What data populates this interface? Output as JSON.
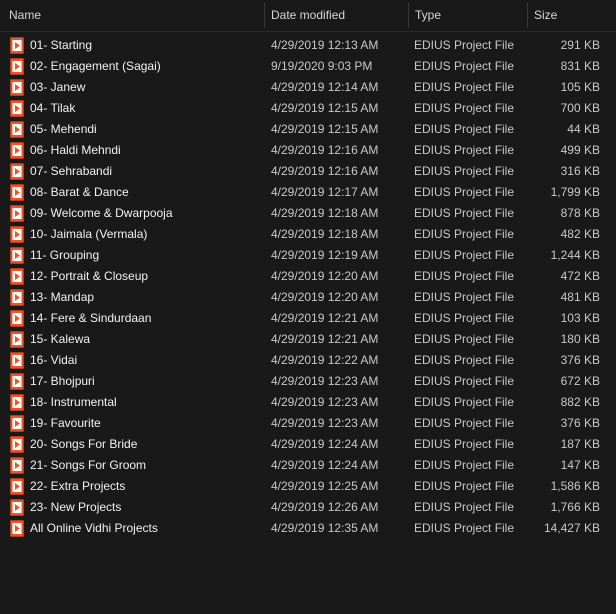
{
  "columns": {
    "name": "Name",
    "date": "Date modified",
    "type": "Type",
    "size": "Size"
  },
  "colors": {
    "icon": "#e8562a",
    "background": "#191919"
  },
  "icon_name": "edius-project-file-icon",
  "files": [
    {
      "name": "01- Starting",
      "date": "4/29/2019 12:13 AM",
      "type": "EDIUS Project File",
      "size": "291 KB"
    },
    {
      "name": "02- Engagement (Sagai)",
      "date": "9/19/2020 9:03 PM",
      "type": "EDIUS Project File",
      "size": "831 KB"
    },
    {
      "name": "03- Janew",
      "date": "4/29/2019 12:14 AM",
      "type": "EDIUS Project File",
      "size": "105 KB"
    },
    {
      "name": "04- Tilak",
      "date": "4/29/2019 12:15 AM",
      "type": "EDIUS Project File",
      "size": "700 KB"
    },
    {
      "name": "05- Mehendi",
      "date": "4/29/2019 12:15 AM",
      "type": "EDIUS Project File",
      "size": "44 KB"
    },
    {
      "name": "06- Haldi Mehndi",
      "date": "4/29/2019 12:16 AM",
      "type": "EDIUS Project File",
      "size": "499 KB"
    },
    {
      "name": "07- Sehrabandi",
      "date": "4/29/2019 12:16 AM",
      "type": "EDIUS Project File",
      "size": "316 KB"
    },
    {
      "name": "08- Barat & Dance",
      "date": "4/29/2019 12:17 AM",
      "type": "EDIUS Project File",
      "size": "1,799 KB"
    },
    {
      "name": "09- Welcome & Dwarpooja",
      "date": "4/29/2019 12:18 AM",
      "type": "EDIUS Project File",
      "size": "878 KB"
    },
    {
      "name": "10- Jaimala (Vermala)",
      "date": "4/29/2019 12:18 AM",
      "type": "EDIUS Project File",
      "size": "482 KB"
    },
    {
      "name": "11- Grouping",
      "date": "4/29/2019 12:19 AM",
      "type": "EDIUS Project File",
      "size": "1,244 KB"
    },
    {
      "name": "12- Portrait & Closeup",
      "date": "4/29/2019 12:20 AM",
      "type": "EDIUS Project File",
      "size": "472 KB"
    },
    {
      "name": "13- Mandap",
      "date": "4/29/2019 12:20 AM",
      "type": "EDIUS Project File",
      "size": "481 KB"
    },
    {
      "name": "14- Fere & Sindurdaan",
      "date": "4/29/2019 12:21 AM",
      "type": "EDIUS Project File",
      "size": "103 KB"
    },
    {
      "name": "15- Kalewa",
      "date": "4/29/2019 12:21 AM",
      "type": "EDIUS Project File",
      "size": "180 KB"
    },
    {
      "name": "16- Vidai",
      "date": "4/29/2019 12:22 AM",
      "type": "EDIUS Project File",
      "size": "376 KB"
    },
    {
      "name": "17- Bhojpuri",
      "date": "4/29/2019 12:23 AM",
      "type": "EDIUS Project File",
      "size": "672 KB"
    },
    {
      "name": "18- Instrumental",
      "date": "4/29/2019 12:23 AM",
      "type": "EDIUS Project File",
      "size": "882 KB"
    },
    {
      "name": "19- Favourite",
      "date": "4/29/2019 12:23 AM",
      "type": "EDIUS Project File",
      "size": "376 KB"
    },
    {
      "name": "20- Songs For Bride",
      "date": "4/29/2019 12:24 AM",
      "type": "EDIUS Project File",
      "size": "187 KB"
    },
    {
      "name": "21- Songs For Groom",
      "date": "4/29/2019 12:24 AM",
      "type": "EDIUS Project File",
      "size": "147 KB"
    },
    {
      "name": "22- Extra Projects",
      "date": "4/29/2019 12:25 AM",
      "type": "EDIUS Project File",
      "size": "1,586 KB"
    },
    {
      "name": "23- New Projects",
      "date": "4/29/2019 12:26 AM",
      "type": "EDIUS Project File",
      "size": "1,766 KB"
    },
    {
      "name": "All Online Vidhi Projects",
      "date": "4/29/2019 12:35 AM",
      "type": "EDIUS Project File",
      "size": "14,427 KB"
    }
  ]
}
